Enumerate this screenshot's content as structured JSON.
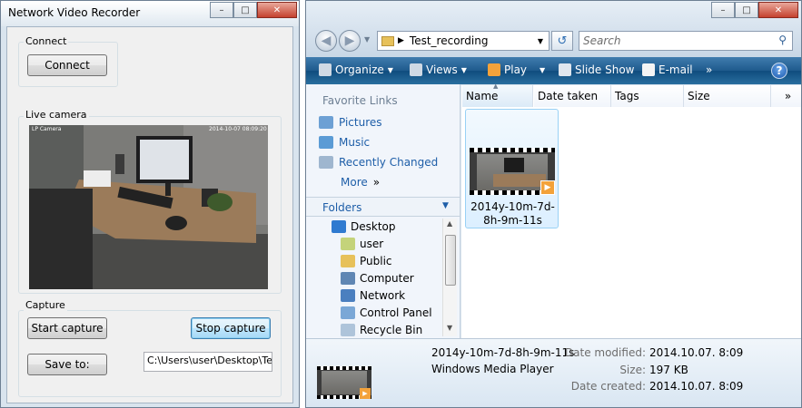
{
  "left_window": {
    "title": "Network Video Recorder",
    "connect_group": "Connect",
    "connect_button": "Connect",
    "live_group": "Live camera",
    "camera_overlay_left": "LP Camera",
    "camera_overlay_right": "2014-10-07 08:09:20",
    "capture_group": "Capture",
    "start_capture": "Start capture",
    "stop_capture": "Stop capture",
    "save_to": "Save to:",
    "save_path": "C:\\Users\\user\\Desktop\\Tes"
  },
  "explorer": {
    "address_folder": "Test_recording",
    "search_placeholder": "Search",
    "commands": {
      "organize": "Organize",
      "views": "Views",
      "play": "Play",
      "slideshow": "Slide Show",
      "email": "E-mail",
      "more": "»"
    },
    "favorite_links_title": "Favorite Links",
    "favorites": [
      "Pictures",
      "Music",
      "Recently Changed"
    ],
    "more_label": "More",
    "more_arrow": "»",
    "folders_title": "Folders",
    "tree": [
      "Desktop",
      "user",
      "Public",
      "Computer",
      "Network",
      "Control Panel",
      "Recycle Bin"
    ],
    "columns": [
      "Name",
      "Date taken",
      "Tags",
      "Size"
    ],
    "column_more": "»",
    "file_name": "2014y-10m-7d-8h-9m-11s",
    "details": {
      "file_name": "2014y-10m-7d-8h-9m-11s",
      "type": "Windows Media Player",
      "modified_label": "Date modified:",
      "modified_value": "2014.10.07. 8:09",
      "size_label": "Size:",
      "size_value": "197 KB",
      "created_label": "Date created:",
      "created_value": "2014.10.07. 8:09"
    }
  },
  "colors": {
    "window_frame": "#d9e4ee",
    "command_bar": "#1f5a8d",
    "link_blue": "#1e5ea8",
    "close_red": "#c5412e"
  }
}
